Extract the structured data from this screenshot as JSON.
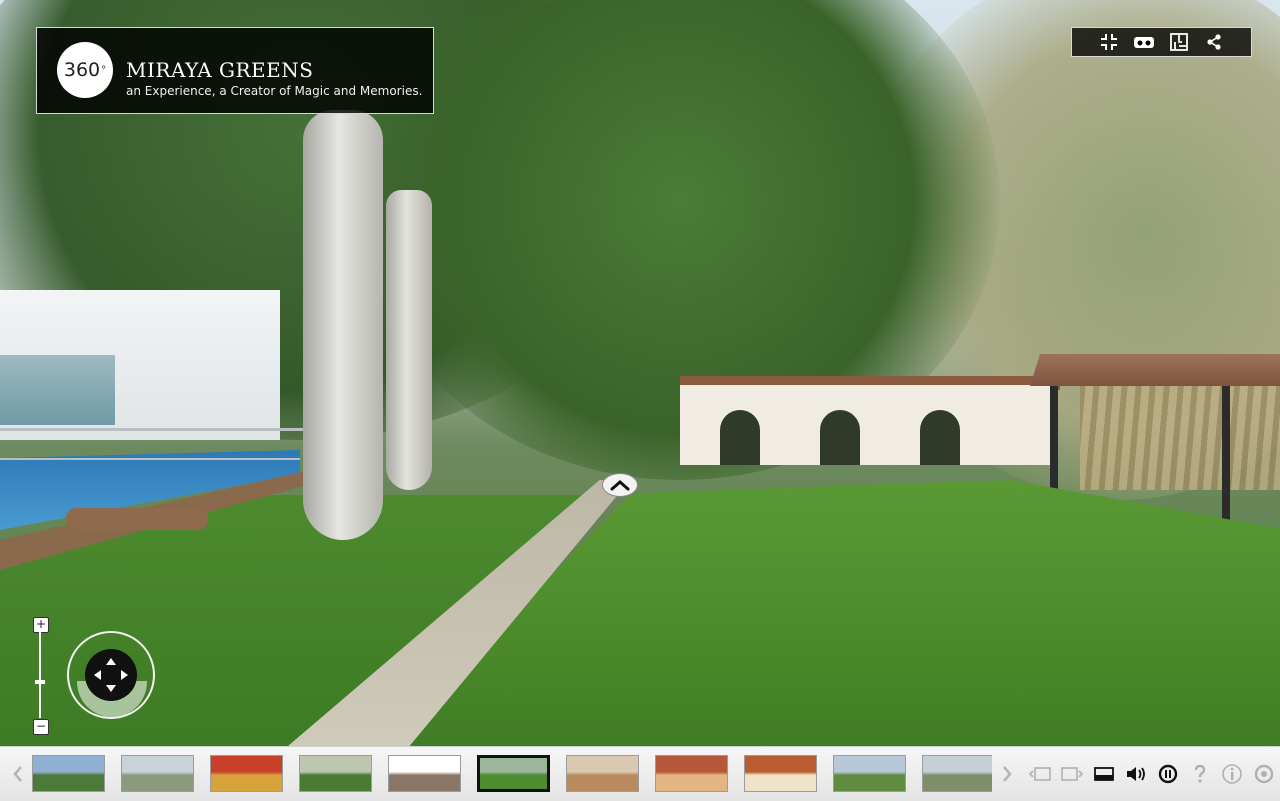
{
  "brand": {
    "logo_text": "360",
    "logo_sup": "°",
    "title": "MIRAYA GREENS",
    "subtitle": "an Experience, a Creator of Magic and Memories."
  },
  "topbar": {
    "icons": [
      "exit-fullscreen-icon",
      "vr-headset-icon",
      "floor-plan-icon",
      "share-icon"
    ]
  },
  "zoom": {
    "plus": "+",
    "minus": "−",
    "level": 0.42
  },
  "thumbnails": {
    "active_index": 6,
    "items": [
      {
        "name": "thumb-0",
        "colors": [
          "#b9c4b8",
          "#6d8a5f"
        ]
      },
      {
        "name": "thumb-1",
        "colors": [
          "#8fb0d2",
          "#4e7a39"
        ]
      },
      {
        "name": "thumb-2",
        "colors": [
          "#c8d2d9",
          "#8c9a7c"
        ]
      },
      {
        "name": "thumb-3",
        "colors": [
          "#c7402a",
          "#d8a23a"
        ]
      },
      {
        "name": "thumb-4",
        "colors": [
          "#bcc6b0",
          "#4a7a33"
        ]
      },
      {
        "name": "thumb-5",
        "colors": [
          "#ffffff",
          "#8a7666"
        ]
      },
      {
        "name": "thumb-6",
        "colors": [
          "#9bb69a",
          "#4f8b30"
        ]
      },
      {
        "name": "thumb-7",
        "colors": [
          "#d8c9b0",
          "#b98a5e"
        ]
      },
      {
        "name": "thumb-8",
        "colors": [
          "#b5583a",
          "#e2b583"
        ]
      },
      {
        "name": "thumb-9",
        "colors": [
          "#b95c2f",
          "#f0e2c6"
        ]
      },
      {
        "name": "thumb-10",
        "colors": [
          "#b8c8d6",
          "#5f8c3f"
        ]
      },
      {
        "name": "thumb-11",
        "colors": [
          "#c4cfd6",
          "#7f8f6a"
        ]
      }
    ]
  },
  "controls": {
    "icons": [
      "previous-panorama-icon",
      "next-panorama-icon",
      "toggle-thumbnails-icon",
      "sound-icon",
      "autorotate-icon",
      "help-icon",
      "info-icon",
      "settings-icon"
    ]
  },
  "colors": {
    "bar_bg": "#ececec",
    "overlay": "#000000"
  }
}
